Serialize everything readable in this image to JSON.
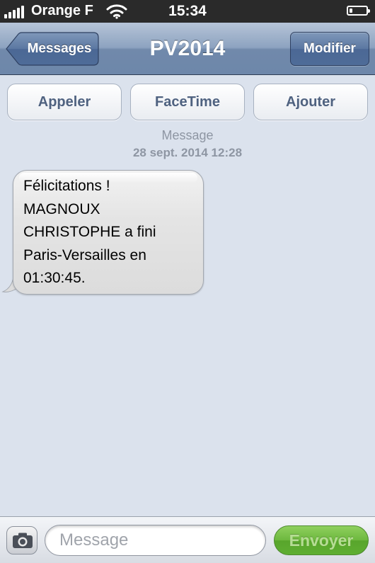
{
  "status_bar": {
    "carrier": "Orange F",
    "time": "15:34",
    "signal_bars": 5,
    "battery_level": 0.2
  },
  "nav": {
    "back_label": "Messages",
    "title": "PV2014",
    "edit_label": "Modifier"
  },
  "actions": {
    "call": "Appeler",
    "facetime": "FaceTime",
    "add": "Ajouter"
  },
  "conversation": {
    "type_label": "Message",
    "timestamp": "28 sept. 2014 12:28",
    "messages": [
      {
        "direction": "incoming",
        "lines": [
          "Félicitations !",
          "MAGNOUX",
          "CHRISTOPHE a fini",
          "Paris-Versailles en",
          "01:30:45."
        ]
      }
    ]
  },
  "composer": {
    "placeholder": "Message",
    "value": "",
    "send_label": "Envoyer",
    "camera_icon": "camera-icon"
  },
  "colors": {
    "background": "#dbe2ed",
    "navbar": "#6d87aa",
    "send_button": "#6db83e",
    "action_text": "#4f6280"
  }
}
